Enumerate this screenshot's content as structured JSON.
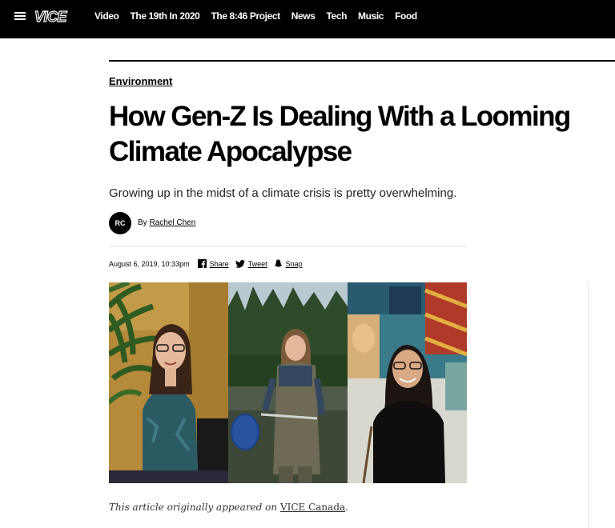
{
  "nav": {
    "logo": "VICE",
    "items": [
      "Video",
      "The 19th In 2020",
      "The 8:46 Project",
      "News",
      "Tech",
      "Music",
      "Food"
    ]
  },
  "article": {
    "category": "Environment",
    "headline": "How Gen-Z Is Dealing With a Looming Climate Apocalypse",
    "dek": "Growing up in the midst of a climate crisis is pretty overwhelming.",
    "author_initials": "RC",
    "by_prefix": "By",
    "author": "Rachel Chen",
    "date": "August 6, 2019, 10:33pm",
    "share": {
      "facebook": "Share",
      "twitter": "Tweet",
      "snapchat": "Snap"
    },
    "note_prefix": "This article originally appeared on",
    "note_link": "VICE Canada",
    "note_suffix": "."
  },
  "colors": {
    "topbar": "#000000",
    "text": "#000000",
    "accent": "#000000"
  },
  "icons": {
    "menu": "hamburger-icon",
    "facebook": "facebook-icon",
    "twitter": "twitter-icon",
    "snapchat": "snapchat-icon"
  }
}
